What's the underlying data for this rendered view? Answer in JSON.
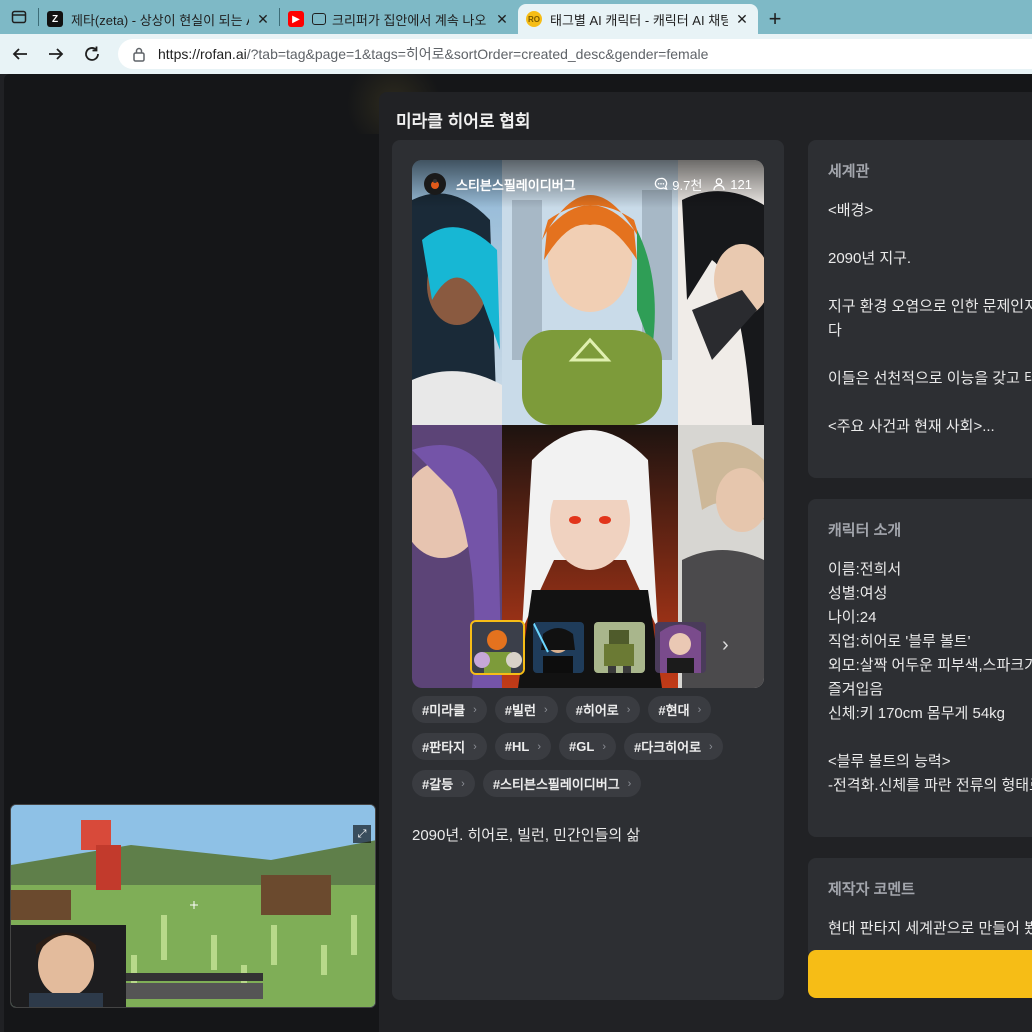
{
  "browser": {
    "tabs": [
      {
        "title": "제타(zeta) - 상상이 현실이 되는 AI",
        "favicon": "zeta-icon",
        "favicon_color": "#111111"
      },
      {
        "title": "크리퍼가 집안에서 계속 나오",
        "favicon": "youtube-icon",
        "favicon_color": "#ff0000"
      },
      {
        "title": "태그별 AI 캐릭터 - 캐릭터 AI 채팅",
        "favicon": "rofan-icon",
        "favicon_color": "#f6bd16"
      }
    ],
    "url_host": "https://rofan.ai",
    "url_rest": "/?tab=tag&page=1&tags=히어로&sortOrder=created_desc&gender=female"
  },
  "modal": {
    "title": "미라클 히어로 협회",
    "creator": "스티븐스필레이디버그",
    "chat_count": "9.7천",
    "user_count": "121",
    "tags": [
      "#미라클",
      "#빌런",
      "#히어로",
      "#현대",
      "#판타지",
      "#HL",
      "#GL",
      "#다크히어로",
      "#갈등",
      "#스티븐스필레이디버그"
    ],
    "description": "2090년. 히어로, 빌런, 민간인들의 삶",
    "world": {
      "heading": "세계관",
      "lines": [
        "<배경>",
        "",
        "2090년 지구.",
        "",
        "지구 환경 오염으로 인한 문제인지",
        "다",
        "",
        "이들은 선천적으로 이능을 갖고 태",
        "",
        "<주요 사건과 현재 사회>..."
      ]
    },
    "intro": {
      "heading": "캐릭터 소개",
      "lines": [
        "이름:전희서",
        "성별:여성",
        "나이:24",
        "직업:히어로 '블루 볼트'",
        "외모:살짝 어두운 피부색,스파크가",
        "즐겨입음",
        "신체:키 170cm 몸무게 54kg",
        "",
        "<블루 볼트의 능력>",
        "-전격화.신체를 파란 전류의 형태로"
      ]
    },
    "comment": {
      "heading": "제작자 코멘트",
      "lines": [
        "현대 판타지 세계관으로 만들어 봤"
      ]
    },
    "accent_color": "#f6bd16"
  }
}
